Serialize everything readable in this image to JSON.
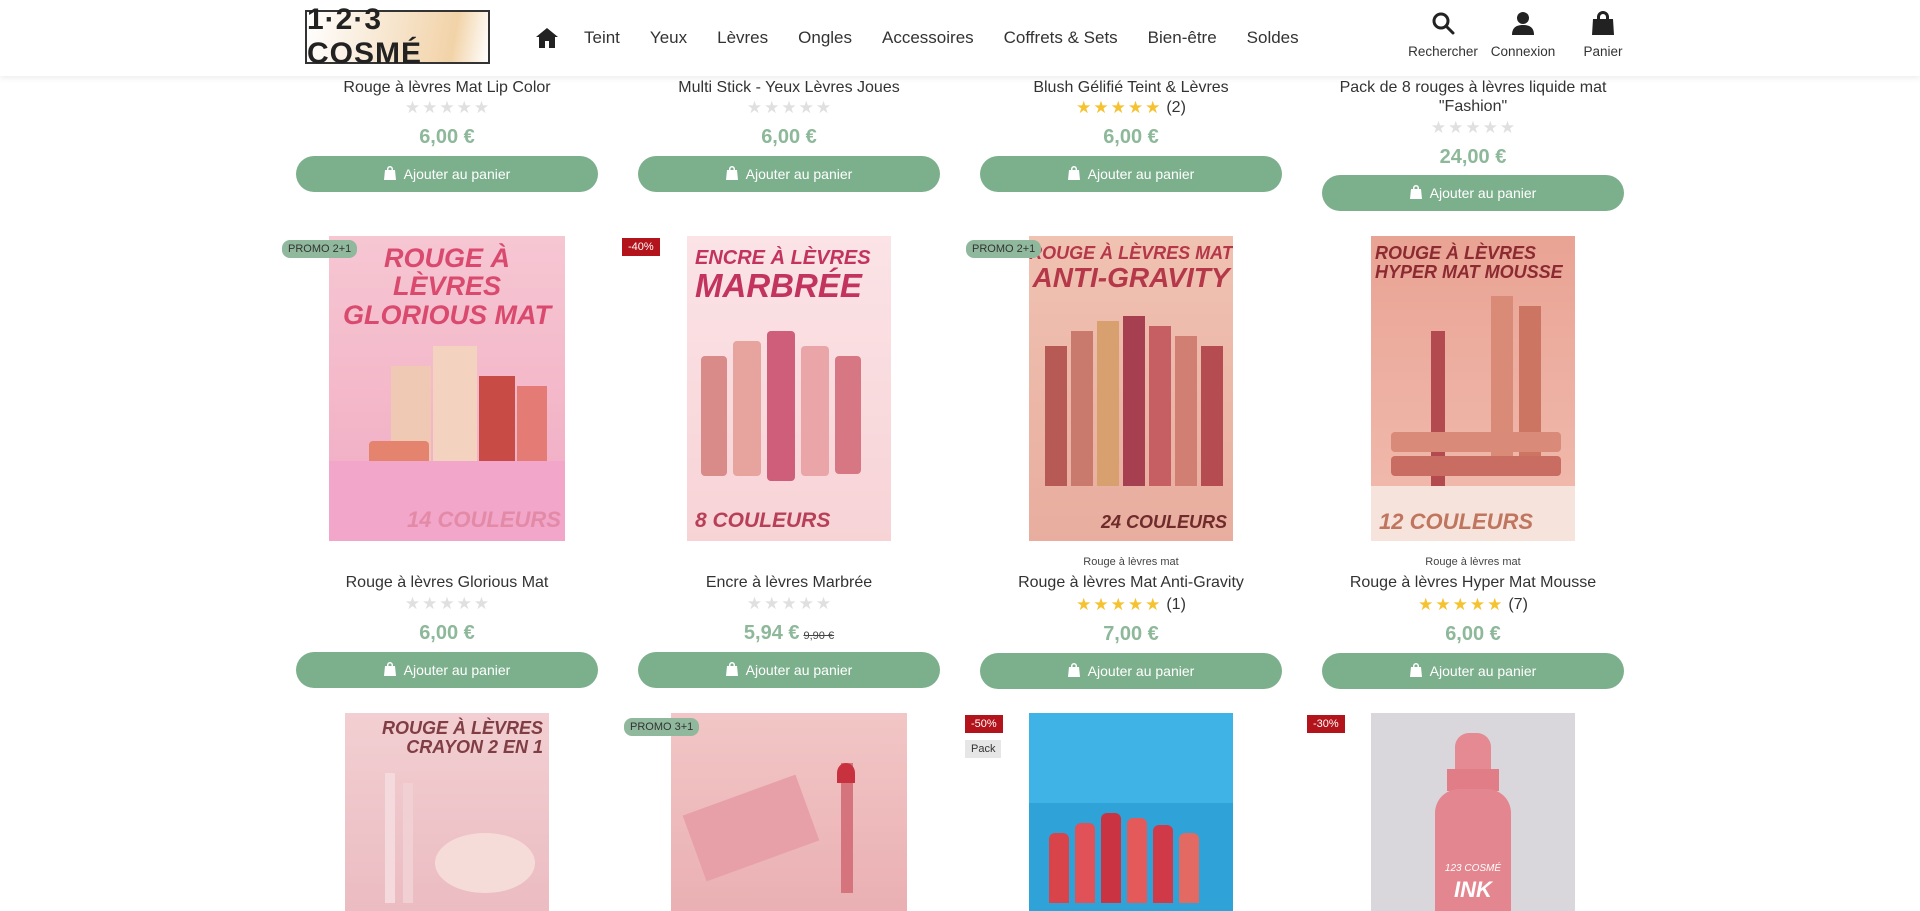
{
  "header": {
    "logo_text": "1·2·3 COSMÉ",
    "nav": [
      "Teint",
      "Yeux",
      "Lèvres",
      "Ongles",
      "Accessoires",
      "Coffrets & Sets",
      "Bien-être",
      "Soldes"
    ],
    "actions": {
      "search": "Rechercher",
      "login": "Connexion",
      "cart": "Panier"
    }
  },
  "add_to_cart_label": "Ajouter au panier",
  "row1": [
    {
      "name": "Rouge à lèvres Mat Lip Color",
      "rating": 0,
      "reviews": "",
      "price": "6,00 €"
    },
    {
      "name": "Multi Stick - Yeux Lèvres Joues",
      "rating": 0,
      "reviews": "",
      "price": "6,00 €"
    },
    {
      "name": "Blush Gélifié Teint & Lèvres",
      "rating": 5,
      "reviews": "(2)",
      "price": "6,00 €"
    },
    {
      "name": "Pack de 8 rouges à lèvres liquide mat \"Fashion\"",
      "rating": 0,
      "reviews": "",
      "price": "24,00 €"
    }
  ],
  "row2": [
    {
      "badge": "PROMO 2+1",
      "badge_type": "promo",
      "img_title_1": "ROUGE À LÈVRES",
      "img_title_2": "GLORIOUS MAT",
      "img_footer": "14 COULEURS",
      "category": "",
      "name": "Rouge à lèvres Glorious Mat",
      "rating": 0,
      "reviews": "",
      "price": "6,00 €",
      "old_price": ""
    },
    {
      "badge": "-40%",
      "badge_type": "red",
      "img_title_1": "ENCRE À LÈVRES",
      "img_title_2": "MARBRÉE",
      "img_footer": "8 COULEURS",
      "category": "",
      "name": "Encre à lèvres Marbrée",
      "rating": 0,
      "reviews": "",
      "price": "5,94 €",
      "old_price": "9,90 €"
    },
    {
      "badge": "PROMO 2+1",
      "badge_type": "promo",
      "img_title_1": "ROUGE À LÈVRES MAT",
      "img_title_2": "ANTI-GRAVITY",
      "img_footer": "24 COULEURS",
      "category": "Rouge à lèvres mat",
      "name": "Rouge à lèvres Mat Anti-Gravity",
      "rating": 5,
      "reviews": "(1)",
      "price": "7,00 €",
      "old_price": ""
    },
    {
      "badge": "",
      "badge_type": "",
      "img_title_1": "ROUGE À LÈVRES",
      "img_title_2": "HYPER MAT MOUSSE",
      "img_footer": "12 COULEURS",
      "category": "Rouge à lèvres mat",
      "name": "Rouge à lèvres Hyper Mat Mousse",
      "rating": 5,
      "reviews": "(7)",
      "price": "6,00 €",
      "old_price": ""
    }
  ],
  "row2_categories": [
    "Rouge à lèvres mat",
    "Rouge à lèvres mat"
  ],
  "row3": [
    {
      "badge": "",
      "badge2": "",
      "img_title_1": "ROUGE À LÈVRES",
      "img_title_2": "CRAYON 2 EN 1"
    },
    {
      "badge": "PROMO 3+1",
      "badge2": "",
      "img_title_1": "",
      "img_title_2": ""
    },
    {
      "badge": "-50%",
      "badge2": "Pack",
      "img_title_1": "",
      "img_title_2": ""
    },
    {
      "badge": "-30%",
      "badge2": "",
      "img_title_1": "",
      "img_title_2": "",
      "bottle_text_1": "123 COSMÉ",
      "bottle_text_2": "INK"
    }
  ],
  "colors": {
    "accent_green": "#7cb08c",
    "price_green": "#8db899",
    "star_gold": "#f5c232",
    "sale_red": "#b3141b"
  }
}
